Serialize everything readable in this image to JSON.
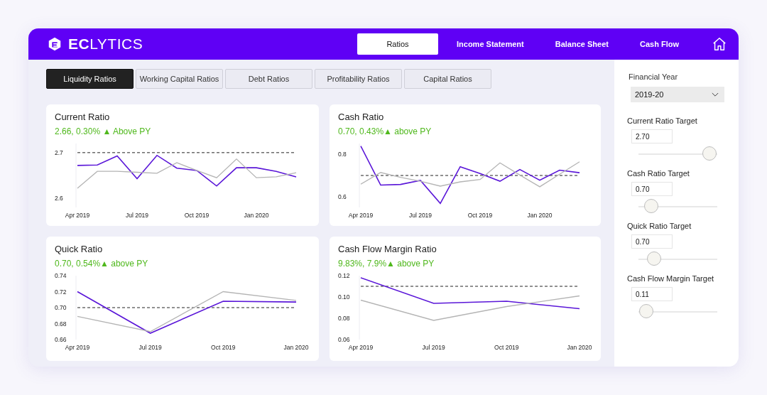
{
  "brand": {
    "name": "**EC**LYTICS"
  },
  "nav": [
    {
      "label": "Ratios",
      "selected": true
    },
    {
      "label": "Income Statement",
      "selected": false
    },
    {
      "label": "Balance Sheet",
      "selected": false
    },
    {
      "label": "Cash Flow",
      "selected": false
    }
  ],
  "tabs": [
    {
      "label": "Liquidity Ratios",
      "selected": true
    },
    {
      "label": "Working Capital Ratios",
      "selected": false
    },
    {
      "label": "Debt Ratios",
      "selected": false
    },
    {
      "label": "Profitability Ratios",
      "selected": false
    },
    {
      "label": "Capital Ratios",
      "selected": false
    }
  ],
  "cards": [
    {
      "title": "Current Ratio",
      "summary": "2.66, 0.30% ▲ Above PY",
      "chart_data": {
        "type": "line",
        "categories": [
          "Apr 2019",
          null,
          null,
          "Jul 2019",
          null,
          null,
          "Oct 2019",
          null,
          null,
          "Jan 2020",
          null,
          null
        ],
        "ylim": [
          2.58,
          2.72
        ],
        "yticks": [
          2.6,
          2.7
        ],
        "series": [
          {
            "color": "#5a16d8",
            "values": [
              2.672,
              2.673,
              2.693,
              2.643,
              2.694,
              2.666,
              2.661,
              2.627,
              2.667,
              2.667,
              2.659,
              2.647
            ]
          },
          {
            "color": "#b4b4b4",
            "values": [
              2.622,
              2.659,
              2.659,
              2.657,
              2.655,
              2.678,
              2.661,
              2.645,
              2.686,
              2.645,
              2.647,
              2.656
            ]
          }
        ],
        "ref_lines": [
          {
            "axis": "y",
            "value": 2.7
          }
        ]
      }
    },
    {
      "title": "Cash Ratio",
      "summary": "0.70, 0.43%▲ above PY",
      "chart_data": {
        "type": "line",
        "categories": [
          "Apr 2019",
          null,
          null,
          "Jul 2019",
          null,
          null,
          "Oct 2019",
          null,
          null,
          "Jan 2020",
          null,
          null
        ],
        "ylim": [
          0.55,
          0.85
        ],
        "yticks": [
          {
            "value": 0.6,
            "label": "0.6"
          },
          {
            "value": 0.8,
            "label": "0.8"
          }
        ],
        "series": [
          {
            "color": "#5a16d8",
            "values": [
              0.838,
              0.655,
              0.658,
              0.677,
              0.569,
              0.741,
              0.709,
              0.673,
              0.728,
              0.678,
              0.725,
              0.713
            ]
          },
          {
            "color": "#b4b4b4",
            "values": [
              0.659,
              0.714,
              0.691,
              0.673,
              0.65,
              0.67,
              0.681,
              0.759,
              0.702,
              0.647,
              0.706,
              0.764
            ]
          }
        ],
        "ref_lines": [
          {
            "axis": "y",
            "value": 0.7
          }
        ]
      }
    },
    {
      "title": "Quick Ratio",
      "summary": "0.70, 0.54%▲ above PY",
      "chart_data": {
        "type": "line",
        "categories": [
          "Apr 2019",
          "Jul 2019",
          "Oct 2019",
          "Jan 2020"
        ],
        "ylim": [
          0.66,
          0.74
        ],
        "yticks": [
          {
            "value": 0.66,
            "label": "0.66"
          },
          {
            "value": 0.68,
            "label": "0.68"
          },
          {
            "value": 0.7,
            "label": "0.70"
          },
          {
            "value": 0.72,
            "label": "0.72"
          },
          {
            "value": 0.74,
            "label": "0.74"
          }
        ],
        "series": [
          {
            "color": "#5a16d8",
            "values": [
              0.72,
              0.668,
              0.708,
              0.707
            ]
          },
          {
            "color": "#b4b4b4",
            "values": [
              0.689,
              0.67,
              0.72,
              0.709
            ]
          }
        ],
        "ref_lines": [
          {
            "axis": "y",
            "value": 0.7
          }
        ]
      }
    },
    {
      "title": "Cash Flow Margin Ratio",
      "summary": "9.83%, 7.9%▲ above PY",
      "chart_data": {
        "type": "line",
        "categories": [
          "Apr 2019",
          "Jul 2019",
          "Oct 2019",
          "Jan 2020"
        ],
        "ylim": [
          0.06,
          0.12
        ],
        "yticks": [
          {
            "value": 0.06,
            "label": "0.06"
          },
          {
            "value": 0.08,
            "label": "0.08"
          },
          {
            "value": 0.1,
            "label": "0.10"
          },
          {
            "value": 0.12,
            "label": "0.12"
          }
        ],
        "series": [
          {
            "color": "#5a16d8",
            "values": [
              0.118,
              0.094,
              0.096,
              0.089
            ]
          },
          {
            "color": "#b4b4b4",
            "values": [
              0.097,
              0.078,
              0.091,
              0.101
            ]
          }
        ],
        "ref_lines": [
          {
            "axis": "y",
            "value": 0.11
          }
        ]
      }
    }
  ],
  "sidebar": {
    "year_label": "Financial Year",
    "year_value": "2019-20",
    "targets": [
      {
        "label": "Current Ratio Target",
        "value": "2.70",
        "level": 0.9
      },
      {
        "label": "Cash Ratio Target",
        "value": "0.70",
        "level": 0.16
      },
      {
        "label": "Quick Ratio Target",
        "value": "0.70",
        "level": 0.2
      },
      {
        "label": "Cash Flow Margin Target",
        "value": "0.11",
        "level": 0.1
      }
    ]
  }
}
